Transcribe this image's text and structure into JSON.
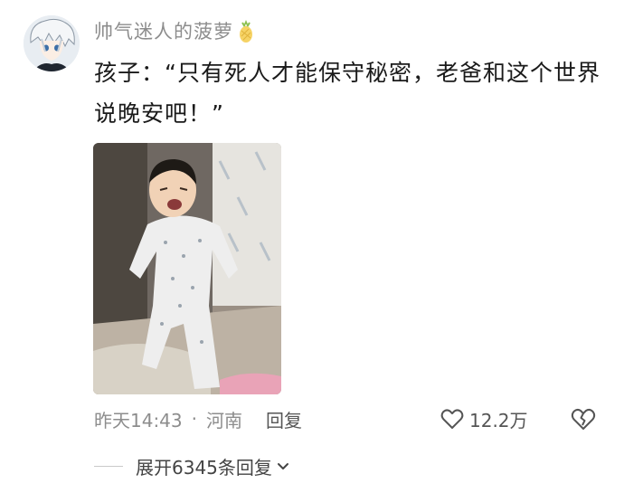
{
  "comment": {
    "username": "帅气迷人的菠萝",
    "text": "孩子：“只有死人才能保守秘密，老爸和这个世界说晚安吧！”",
    "timestamp": "昨天14:43",
    "separator": "·",
    "location": "河南",
    "reply_label": "回复",
    "like_count": "12.2万",
    "expand_label": "展开6345条回复"
  },
  "icons": {
    "avatar": "anime-avatar",
    "badge": "pineapple-icon",
    "like": "heart-outline-icon",
    "dislike": "broken-heart-icon",
    "expand": "chevron-down-icon"
  },
  "colors": {
    "username": "#8d8d8d",
    "text": "#1a1a1a",
    "meta": "#8d8d8d"
  }
}
